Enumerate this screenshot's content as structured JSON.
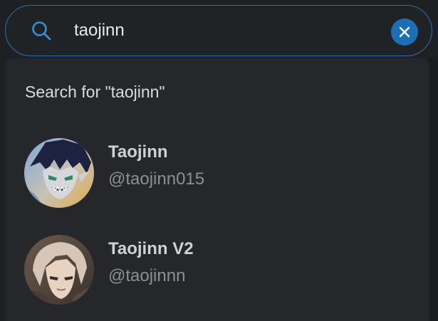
{
  "search": {
    "query": "taojinn",
    "search_icon": "search-icon",
    "clear_icon": "close-icon"
  },
  "dropdown": {
    "search_for_label": "Search for \"taojinn\"",
    "results": [
      {
        "name": "Taojinn",
        "handle": "@taojinn015",
        "avatar": "avatar-dark-haired-character"
      },
      {
        "name": "Taojinn V2",
        "handle": "@taojinnn",
        "avatar": "avatar-light-haired-character"
      }
    ]
  },
  "colors": {
    "background": "#1e2023",
    "dropdown": "#25272a",
    "accent": "#1d6fb5",
    "border": "#2f6fa7",
    "text_primary": "#cfd2d4",
    "text_secondary": "#8b9094"
  }
}
